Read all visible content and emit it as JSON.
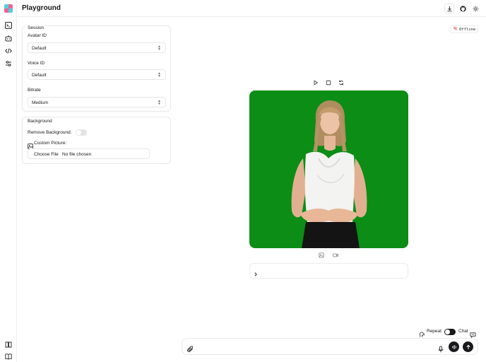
{
  "header": {
    "title": "Playground"
  },
  "session": {
    "title": "Session",
    "avatar": {
      "label": "Avatar ID",
      "value": "Default"
    },
    "voice": {
      "label": "Voice ID",
      "value": "Default"
    },
    "bitrate": {
      "label": "Bitrate",
      "value": "Medium"
    }
  },
  "background": {
    "title": "Background",
    "remove_label": "Remove Background:",
    "remove_enabled": false,
    "custom_label": "Custom Picture:",
    "file_button": "Choose File",
    "file_status": "No file chosen"
  },
  "status": {
    "text": "Offline",
    "color": "#ef4444"
  },
  "input": {
    "repeat_label": "Repeat",
    "chat_label": "Chat",
    "mode_toggle_on": true
  },
  "icons": {
    "rail": [
      "terminal-icon",
      "robot-icon",
      "code-icon",
      "sliders-icon",
      "book-icon",
      "book-open-icon"
    ],
    "header": [
      "download-icon",
      "github-icon",
      "sun-icon"
    ],
    "video_controls": [
      "play-icon",
      "stop-icon",
      "refresh-icon"
    ],
    "capture": [
      "image-icon",
      "video-camera-icon"
    ]
  },
  "colors": {
    "accent": "#18181b",
    "video_bg": "#0b8d16"
  }
}
